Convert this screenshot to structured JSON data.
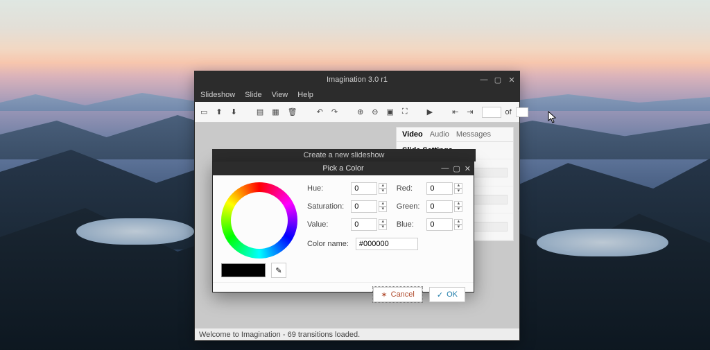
{
  "app": {
    "title": "Imagination 3.0 r1",
    "menu": {
      "m0": "Slideshow",
      "m1": "Slide",
      "m2": "View",
      "m3": "Help"
    },
    "toolbar_of": "of",
    "statusbar": "Welcome to Imagination - 69 transitions loaded."
  },
  "sidepanel": {
    "tabs": {
      "t0": "Video",
      "t1": "Audio",
      "t2": "Messages"
    },
    "section0": "Slide Settings"
  },
  "subdialog": {
    "title": "Create a new slideshow"
  },
  "colorpicker": {
    "title": "Pick a Color",
    "labels": {
      "hue": "Hue:",
      "sat": "Saturation:",
      "val": "Value:",
      "red": "Red:",
      "green": "Green:",
      "blue": "Blue:",
      "colorname": "Color name:"
    },
    "values": {
      "hue": "0",
      "sat": "0",
      "val": "0",
      "red": "0",
      "green": "0",
      "blue": "0",
      "colorname": "#000000"
    },
    "swatch_color": "#000000",
    "buttons": {
      "cancel": "Cancel",
      "ok": "OK"
    }
  }
}
